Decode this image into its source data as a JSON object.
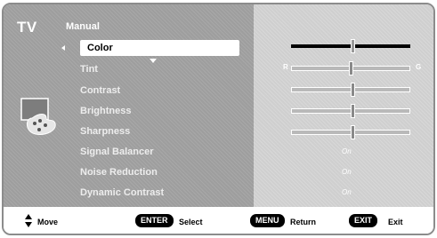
{
  "header": {
    "tv_label": "TV",
    "menu_title": "Manual"
  },
  "menu": {
    "items": [
      {
        "label": "Color",
        "selected": true
      },
      {
        "label": "Tint"
      },
      {
        "label": "Contrast"
      },
      {
        "label": "Brightness"
      },
      {
        "label": "Sharpness"
      },
      {
        "label": "Signal Balancer"
      },
      {
        "label": "Noise Reduction"
      },
      {
        "label": "Dynamic Contrast"
      }
    ]
  },
  "sliders": {
    "color": {
      "level": 0.52
    },
    "tint": {
      "left_label": "R",
      "right_label": "G",
      "level": 0.5
    },
    "contrast": {
      "level": 0.52
    },
    "brightness": {
      "level": 0.52
    },
    "sharpness": {
      "level": 0.52
    }
  },
  "settings": {
    "signal_balancer": "On",
    "noise_reduction": "On",
    "dynamic_contrast": "On"
  },
  "footer": {
    "move_label": "Move",
    "enter_key": "ENTER",
    "select_label": "Select",
    "menu_key": "MENU",
    "return_label": "Return",
    "exit_key": "EXIT",
    "exit_label": "Exit"
  },
  "icons": [
    "up-down-arrow-icon",
    "palette-icon",
    "left-arrow-icon",
    "down-arrow-icon"
  ]
}
